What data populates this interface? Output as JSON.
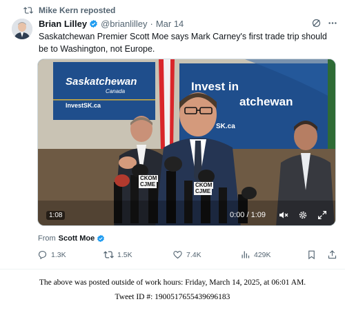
{
  "repost": {
    "text": "Mike Kern reposted",
    "icon": "repost-icon"
  },
  "author": {
    "name": "Brian Lilley",
    "handle": "@brianlilley",
    "separator": "·",
    "date": "Mar 14",
    "avatar": "author-avatar"
  },
  "tweet": {
    "text": "Saskatchewan Premier Scott Moe says Mark Carney's first trade trip should be to Washington, not Europe."
  },
  "video": {
    "sign_left_title": "Saskatchewan",
    "sign_left_sub": "Canada",
    "sign_left_url": "InvestSK.ca",
    "sign_right_line1": "Invest in",
    "sign_right_line2": "atchewan",
    "sign_right_url": "SK.ca",
    "mic_labels": [
      "CKOM",
      "CJME",
      "CKOM",
      "CJME"
    ],
    "elapsed_badge": "1:08",
    "playback_time": "0:00 / 1:09"
  },
  "source": {
    "prefix": "From",
    "name": "Scott Moe"
  },
  "actions": {
    "replies": "1.3K",
    "reposts": "1.5K",
    "likes": "7.4K",
    "views": "429K"
  },
  "footer": {
    "posted_note": "The above was posted outside of work hours: Friday, March 14, 2025, at 06:01 AM.",
    "tweet_id": "Tweet ID #: 1900517655439696183"
  },
  "colors": {
    "verified": "#1d9bf0",
    "muted": "#536471",
    "sign_blue": "#1f4e8c"
  }
}
